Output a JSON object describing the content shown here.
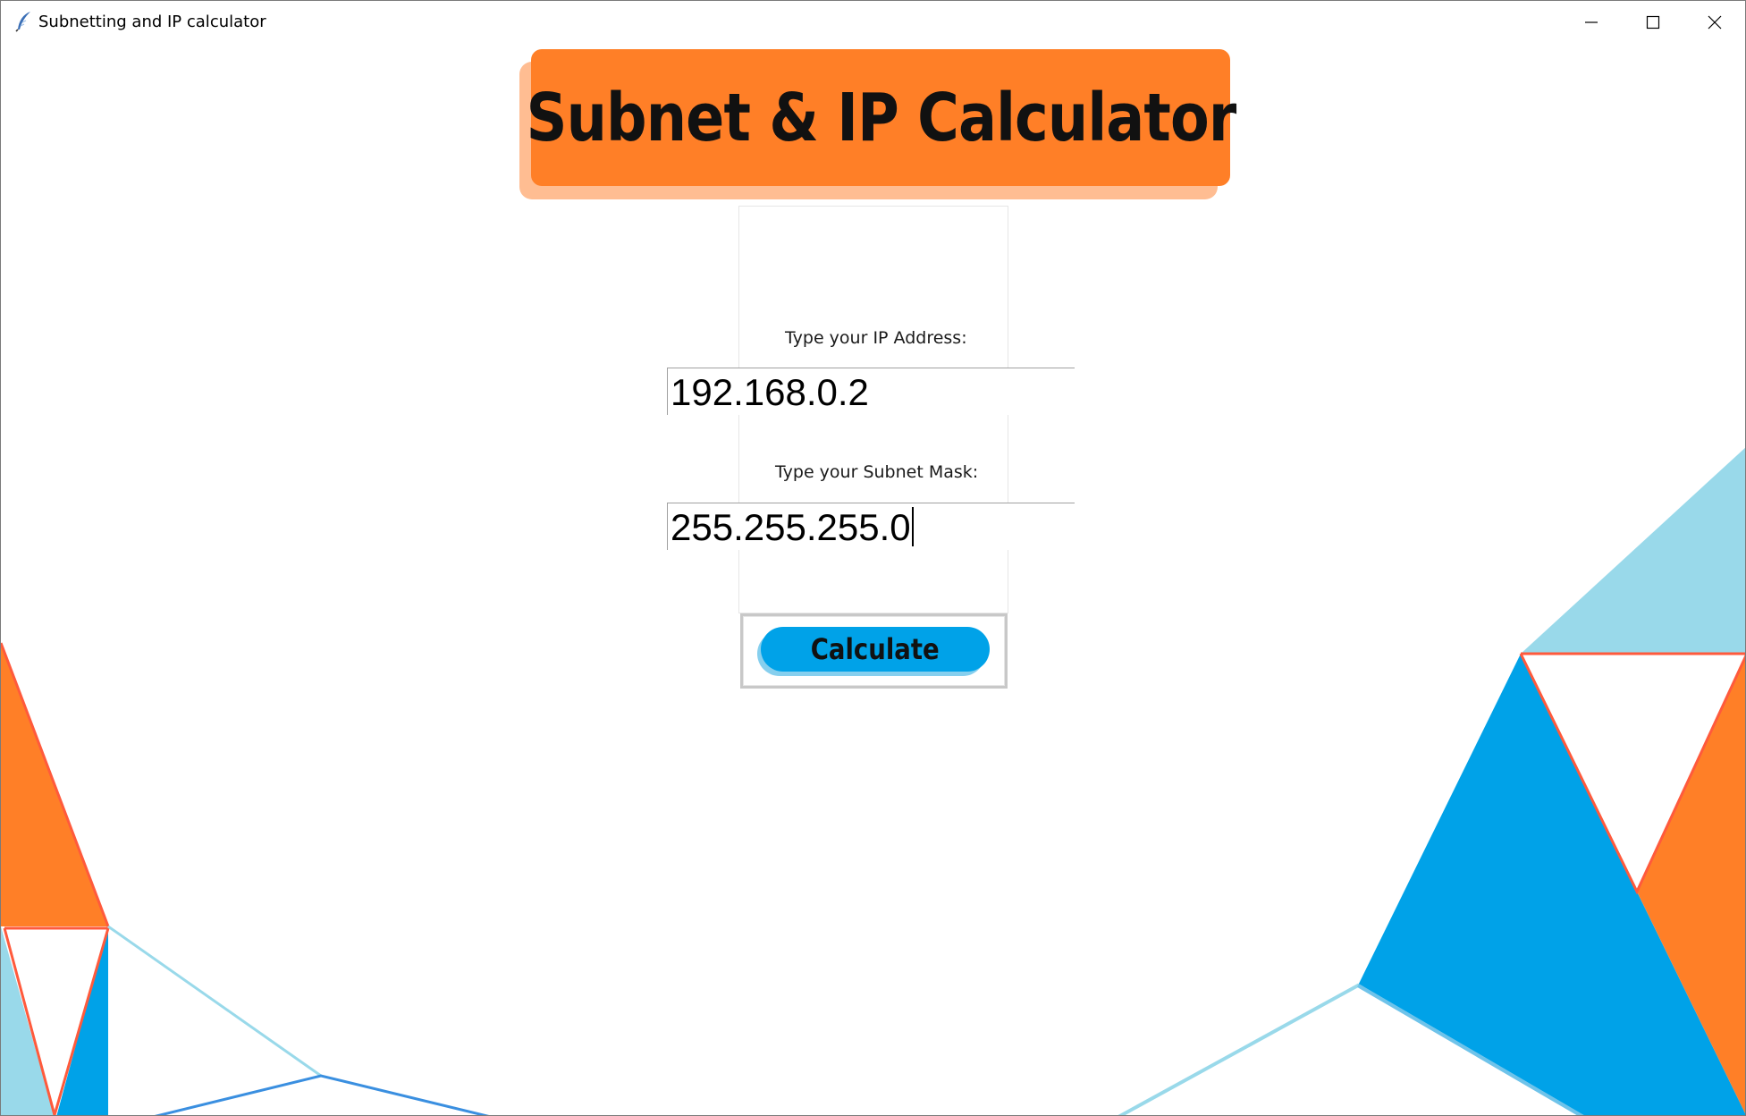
{
  "window": {
    "title": "Subnetting and IP calculator",
    "controls": {
      "minimize_icon": "minimize-icon",
      "maximize_icon": "maximize-icon",
      "close_icon": "close-icon"
    }
  },
  "app_icon": "feather-icon",
  "banner": {
    "title": "Subnet & IP Calculator",
    "color": "#ff7f27",
    "shadow_color": "#ffbd92"
  },
  "form": {
    "ip": {
      "label": "Type your IP Address:",
      "value": "192.168.0.2"
    },
    "mask": {
      "label": "Type your Subnet Mask:",
      "value": "255.255.255.0"
    },
    "calculate_label": "Calculate",
    "button_color": "#00a2e8"
  },
  "palette": {
    "orange": "#ff7f27",
    "blue": "#00a2e8",
    "light_blue": "#99d9ea",
    "red_line": "#ff5a3c"
  }
}
